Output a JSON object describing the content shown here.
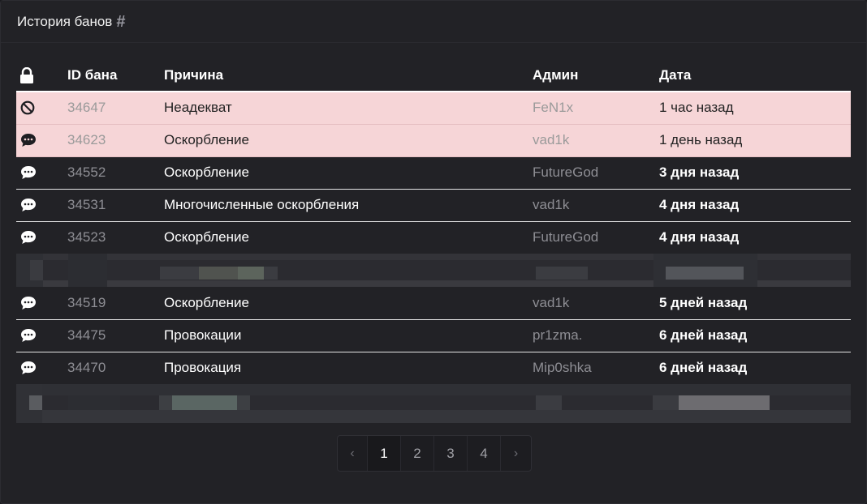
{
  "panel": {
    "title": "История банов",
    "title_icon": "hash-icon"
  },
  "table": {
    "headers": {
      "icon": "lock-icon",
      "id": "ID бана",
      "reason": "Причина",
      "admin": "Админ",
      "date": "Дата"
    },
    "rows": [
      {
        "icon": "ban-icon",
        "id": "34647",
        "reason": "Неадекват",
        "admin": "FeN1x",
        "date": "1 час назад",
        "highlighted": true
      },
      {
        "icon": "chat-icon",
        "id": "34623",
        "reason": "Оскорбление",
        "admin": "vad1k",
        "date": "1 день назад",
        "highlighted": true
      },
      {
        "icon": "chat-icon",
        "id": "34552",
        "reason": "Оскорбление",
        "admin": "FutureGod",
        "date": "3 дня назад",
        "highlighted": false
      },
      {
        "icon": "chat-icon",
        "id": "34531",
        "reason": "Многочисленные оскорбления",
        "admin": "vad1k",
        "date": "4 дня назад",
        "highlighted": false
      },
      {
        "icon": "chat-icon",
        "id": "34523",
        "reason": "Оскорбление",
        "admin": "FutureGod",
        "date": "4 дня назад",
        "highlighted": false
      },
      {
        "icon": "chat-icon",
        "id": "34519",
        "reason": "Оскорбление",
        "admin": "vad1k",
        "date": "5 дней назад",
        "highlighted": false
      },
      {
        "icon": "chat-icon",
        "id": "34475",
        "reason": "Провокации",
        "admin": "pr1zma.",
        "date": "6 дней назад",
        "highlighted": false
      },
      {
        "icon": "chat-icon",
        "id": "34470",
        "reason": "Провокация",
        "admin": "Mip0shka",
        "date": "6 дней назад",
        "highlighted": false
      }
    ]
  },
  "pagination": {
    "prev": "‹",
    "next": "›",
    "pages": [
      "1",
      "2",
      "3",
      "4"
    ],
    "current": "1"
  },
  "colors": {
    "highlight_row": "#f6d5d7",
    "background": "#222226",
    "muted_text": "#8e8e94"
  }
}
